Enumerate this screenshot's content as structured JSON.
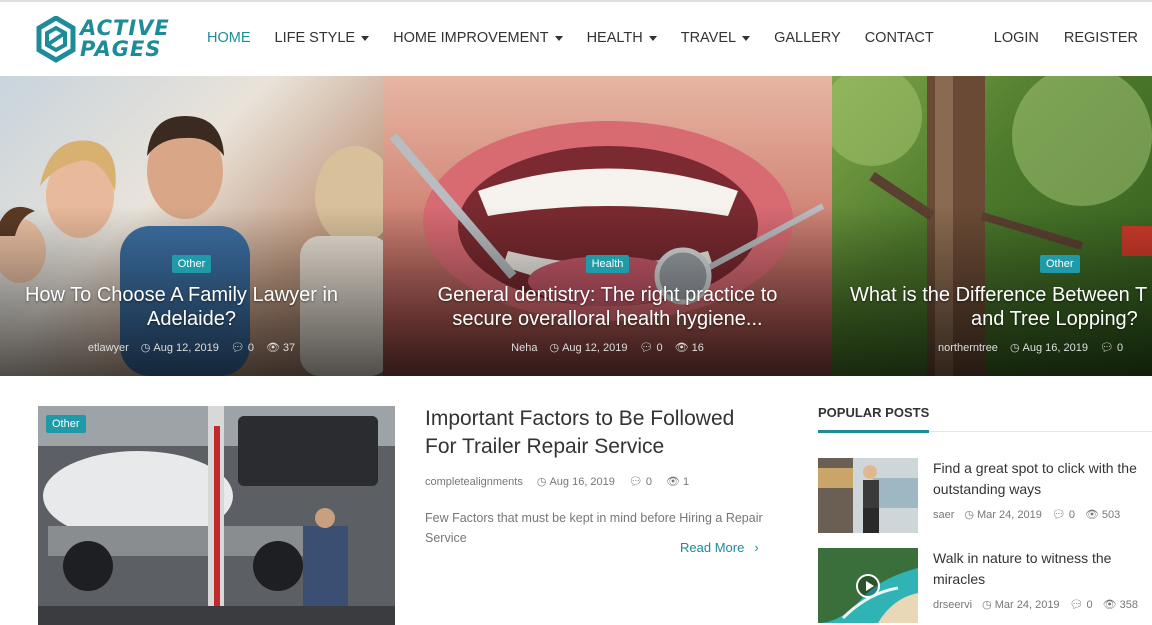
{
  "logo": {
    "line1": "ACTIVE",
    "line2": "PAGES"
  },
  "nav": {
    "items": [
      {
        "label": "HOME",
        "dropdown": false
      },
      {
        "label": "LIFE STYLE",
        "dropdown": true
      },
      {
        "label": "HOME IMPROVEMENT",
        "dropdown": true
      },
      {
        "label": "HEALTH",
        "dropdown": true
      },
      {
        "label": "TRAVEL",
        "dropdown": true
      },
      {
        "label": "GALLERY",
        "dropdown": false
      },
      {
        "label": "CONTACT",
        "dropdown": false
      }
    ],
    "login": "LOGIN",
    "register": "REGISTER"
  },
  "slides": [
    {
      "category": "Other",
      "title_line1": "How To Choose A Family Lawyer in",
      "title_line2": "Adelaide?",
      "author": "etlawyer",
      "date": "Aug 12, 2019",
      "comments": "0",
      "views": "37"
    },
    {
      "category": "Health",
      "title_line1": "General dentistry: The right practice to",
      "title_line2": "secure overalloral health hygiene...",
      "author": "Neha",
      "date": "Aug 12, 2019",
      "comments": "0",
      "views": "16"
    },
    {
      "category": "Other",
      "title_line1": "What is the Difference Between T",
      "title_line2": "and Tree Lopping?",
      "author": "northerntree",
      "date": "Aug 16, 2019",
      "comments": "0",
      "views": ""
    }
  ],
  "article": {
    "category": "Other",
    "title_line1": "Important Factors to Be Followed",
    "title_line2": "For Trailer Repair Service",
    "author": "completealignments",
    "date": "Aug 16, 2019",
    "comments": "0",
    "views": "1",
    "excerpt": "Few Factors that must be kept in mind before Hiring a Repair Service",
    "read_more": "Read More"
  },
  "popular": {
    "heading": "POPULAR POSTS",
    "items": [
      {
        "title_line1": "Find a great spot to click with the",
        "title_line2": "outstanding ways",
        "author": "saer",
        "date": "Mar 24, 2019",
        "comments": "0",
        "views": "503"
      },
      {
        "title_line1": "Walk in nature to witness the",
        "title_line2": "miracles",
        "author": "drseervi",
        "date": "Mar 24, 2019",
        "comments": "0",
        "views": "358"
      }
    ]
  },
  "colors": {
    "accent": "#1e8b9b",
    "badge": "#1e9aa8"
  },
  "icons": {
    "clock": "clock-icon",
    "comment": "comment-icon",
    "eye": "eye-icon",
    "chevron": "chevron-right-icon"
  }
}
